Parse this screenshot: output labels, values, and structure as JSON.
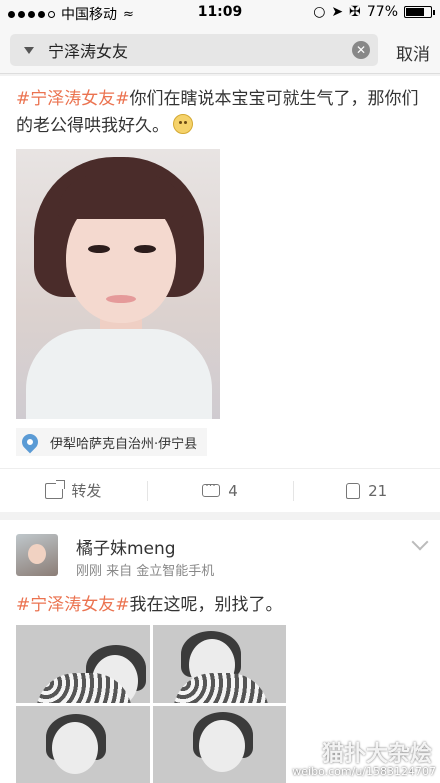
{
  "status_bar": {
    "carrier": "中国移动",
    "time": "11:09",
    "battery": "77%",
    "battery_level": 0.77
  },
  "search": {
    "query": "宁泽涛女友",
    "cancel_label": "取消"
  },
  "post1": {
    "hashtag": "#宁泽涛女友#",
    "text": "你们在瞎说本宝宝可就生气了，那你们的老公得哄我好久。",
    "location": "伊犁哈萨克自治州·伊宁县",
    "repost_label": "转发",
    "comment_count": "4",
    "like_count": "21"
  },
  "post2": {
    "username": "橘子妹meng",
    "meta": "刚刚  来自 金立智能手机",
    "hashtag": "#宁泽涛女友#",
    "text": "我在这呢，别找了。"
  },
  "watermark": {
    "title": "猫扑大杂烩",
    "url": "weibo.com/u/1583124707"
  }
}
